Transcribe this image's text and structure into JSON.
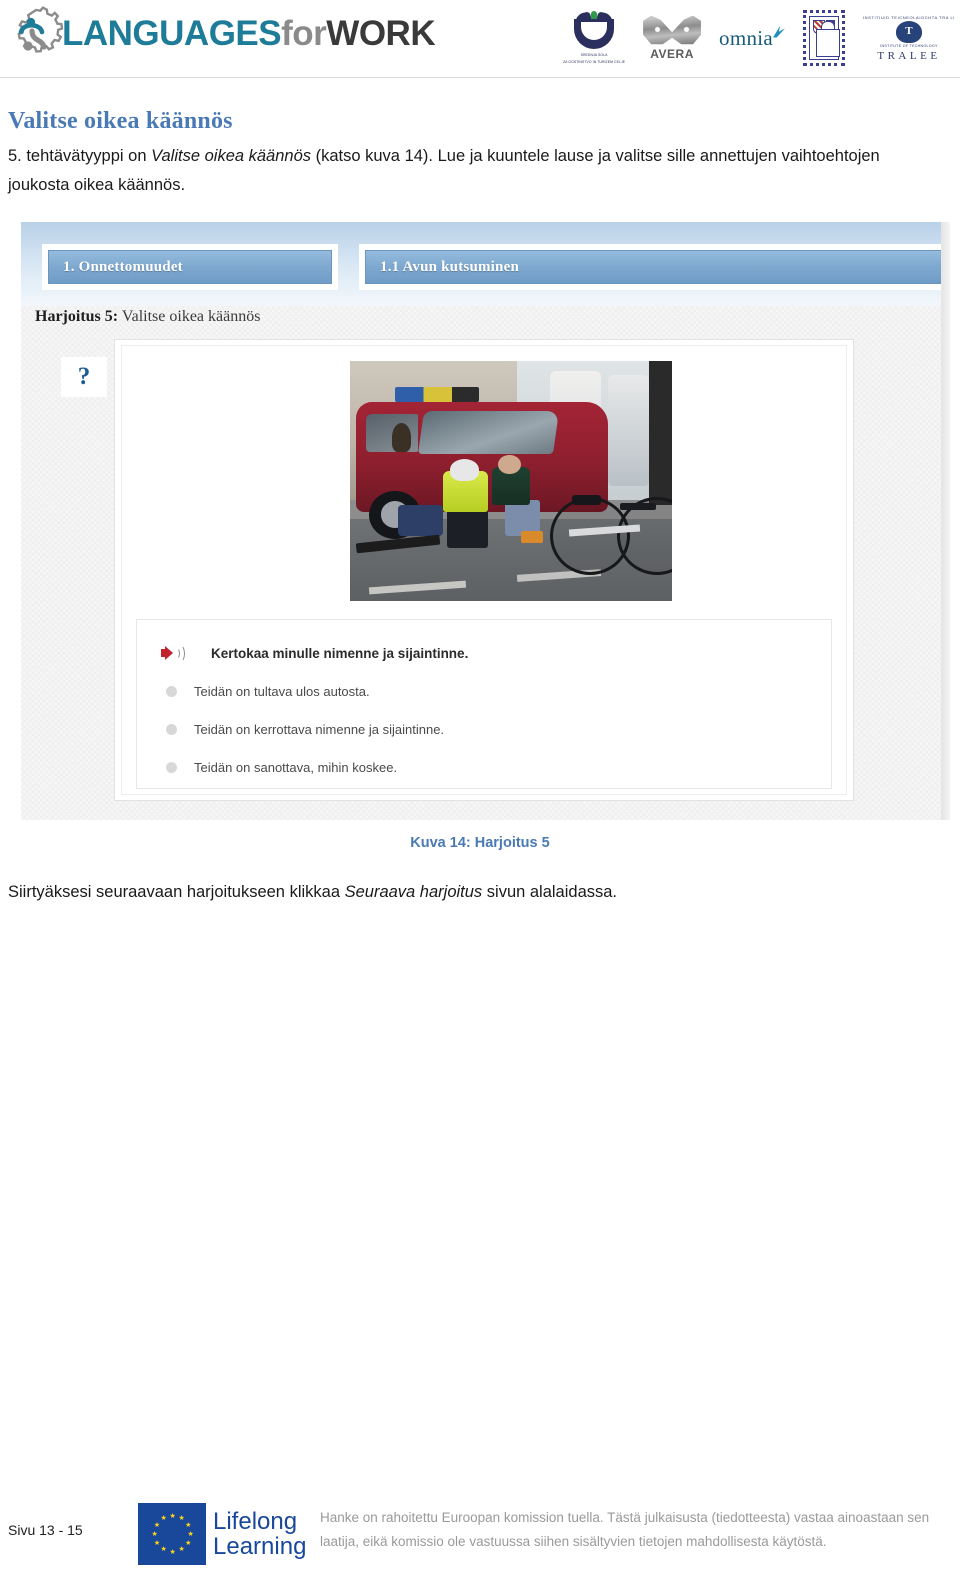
{
  "header": {
    "brand": {
      "part1": "LANGUAGES",
      "part2": "for",
      "part3": "WORK",
      "icon": "gear-person-logo"
    },
    "partners": [
      {
        "name": "srednja-sola-logo",
        "line1": "SREDNJA  SOLA",
        "line2": "ZA GOSTINSTVO IN TURIZEM CELJE"
      },
      {
        "name": "avera-logo",
        "label": "AVERA"
      },
      {
        "name": "omnia-logo",
        "label": "omnia"
      },
      {
        "name": "crest-stamp-logo",
        "label": ""
      },
      {
        "name": "tralee-logo",
        "arc": "INSTITIUID TEICNEOLAIOCHTA  TRA LI",
        "badge": "T",
        "sub": "INSTITUTE OF TECHNOLOGY",
        "name_text": "TRALEE"
      }
    ]
  },
  "document": {
    "title": "Valitse oikea käännös",
    "intro": {
      "before_italic": "5. tehtävätyyppi on ",
      "italic": "Valitse oikea käännös",
      "after_italic": " (katso kuva 14). Lue ja kuuntele lause ja valitse sille annettujen vaihtoehtojen joukosta oikea käännös."
    },
    "caption": "Kuva 14: Harjoitus 5",
    "followup": {
      "before_italic": "Siirtyäksesi seuraavaan harjoitukseen klikkaa ",
      "italic": "Seuraava harjoitus",
      "after_italic": " sivun alalaidassa."
    }
  },
  "figure": {
    "nav_tabs": [
      {
        "label": "1. Onnettomuudet"
      },
      {
        "label": "1.1 Avun kutsuminen"
      }
    ],
    "exercise_label_bold": "Harjoitus 5:",
    "exercise_label_rest": " Valitse oikea käännös",
    "help_icon": "question-mark-icon",
    "photo_alt": "bicycle-accident-photo",
    "prompt": {
      "icon": "speaker-play-icon",
      "text": "Kertokaa minulle nimenne ja sijaintinne."
    },
    "options": [
      {
        "text": "Teidän on tultava ulos autosta.",
        "selected": false
      },
      {
        "text": "Teidän on kerrottava nimenne ja sijaintinne.",
        "selected": false
      },
      {
        "text": "Teidän on sanottava, mihin koskee.",
        "selected": false
      }
    ]
  },
  "footer": {
    "page_number": "Sivu 13 - 15",
    "lifelong_logo": {
      "line1": "Lifelong",
      "line2": "Learning",
      "icon": "eu-flag-icon"
    },
    "disclaimer": "Hanke on rahoitettu Euroopan komission tuella. Tästä julkaisusta (tiedotteesta) vastaa ainoastaan sen laatija, eikä komissio ole vastuussa siihen sisältyvien tietojen mahdollisesta käytöstä."
  },
  "colors": {
    "heading_blue": "#4A7AB5",
    "brand_teal": "#1E7C99",
    "nav_tab_blue": "#7EA8CF",
    "speaker_red": "#C0232C",
    "eu_blue": "#19489B",
    "disclaimer_gray": "#9A9A9A"
  }
}
